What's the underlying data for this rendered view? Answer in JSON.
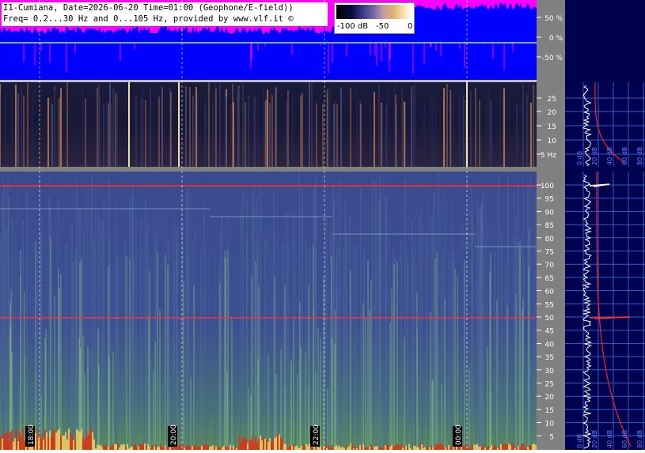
{
  "header": {
    "line1": "I1-Cumiana, Date=2026-06-20 Time=01:00 (Geophone/E-field))",
    "line2": "Freq= 0.2...30 Hz and 0...105 Hz, provided by www.vlf.it ©"
  },
  "color_scale": {
    "min_label": "-100 dB",
    "mid_label": "-50",
    "max_label": "0"
  },
  "amplitude_axis": {
    "ticks": [
      "50 %",
      "0 %",
      "-50 %"
    ]
  },
  "elf_axis": {
    "ticks": [
      "25",
      "20",
      "15",
      "10",
      "5 Hz"
    ]
  },
  "vlf_axis": {
    "ticks": [
      "100",
      "95",
      "90",
      "85",
      "80",
      "75",
      "70",
      "65",
      "60",
      "55",
      "50",
      "45",
      "40",
      "35",
      "30",
      "25",
      "20",
      "15",
      "10",
      "5"
    ]
  },
  "time_labels": [
    "18:00",
    "20:00",
    "22:00",
    "00:00"
  ],
  "spectrum_labels": {
    "top": [
      "0 dB",
      "20 dB",
      "40 dB",
      "60 dB",
      "80 dB"
    ],
    "bottom": [
      "0 dB",
      "20 dB",
      "40 dB",
      "60 dB",
      "80 dB"
    ]
  },
  "colors": {
    "amplitude_bg": "#0000ff",
    "amplitude_fill": "#ff00ff",
    "spectrogram_top_bg": "#14142e",
    "spectrogram_bottom_bg": "#35407a",
    "panel_bg": "#000050",
    "axis_strip": "#808080",
    "marker_line": "#ff3030"
  }
}
